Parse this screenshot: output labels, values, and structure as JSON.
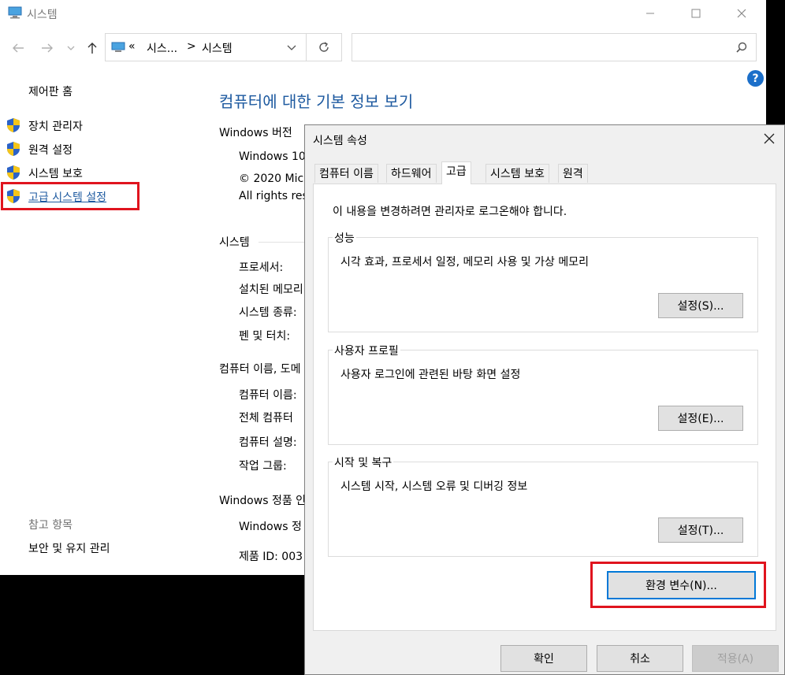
{
  "window": {
    "title": "시스템",
    "address": {
      "prefix": "«",
      "crumb1": "시스...",
      "sep": ">",
      "crumb2": "시스템"
    },
    "search_placeholder": "",
    "help": "?"
  },
  "sidebar": {
    "home": "제어판 홈",
    "items": [
      {
        "label": "장치 관리자"
      },
      {
        "label": "원격 설정"
      },
      {
        "label": "시스템 보호"
      },
      {
        "label": "고급 시스템 설정"
      }
    ],
    "see_also_heading": "참고 항목",
    "see_also": [
      {
        "label": "보안 및 유지 관리"
      }
    ]
  },
  "main": {
    "title": "컴퓨터에 대한 기본 정보 보기",
    "windows_edition": {
      "heading": "Windows 버전",
      "line1": "Windows 10",
      "line2": "© 2020 Mic",
      "line3": "All rights res"
    },
    "system": {
      "heading": "시스템",
      "rows": [
        "프로세서:",
        "설치된 메모리",
        "시스템 종류:",
        "펜 및 터치:"
      ]
    },
    "computer_name": {
      "heading": "컴퓨터 이름, 도메",
      "rows": [
        "컴퓨터 이름:",
        "전체 컴퓨터",
        "컴퓨터 설명:",
        "작업 그룹:"
      ]
    },
    "activation": {
      "heading": "Windows 정품 인",
      "line1": "Windows 정",
      "line2": "제품 ID: 003"
    }
  },
  "dialog": {
    "title": "시스템 속성",
    "tabs": [
      "컴퓨터 이름",
      "하드웨어",
      "고급",
      "시스템 보호",
      "원격"
    ],
    "active_tab": "고급",
    "admin_note": "이 내용을 변경하려면 관리자로 로그온해야 합니다.",
    "groups": [
      {
        "label": "성능",
        "desc": "시각 효과, 프로세서 일정, 메모리 사용 및 가상 메모리",
        "button": "설정(S)..."
      },
      {
        "label": "사용자 프로필",
        "desc": "사용자 로그인에 관련된 바탕 화면 설정",
        "button": "설정(E)..."
      },
      {
        "label": "시작 및 복구",
        "desc": "시스템 시작, 시스템 오류 및 디버깅 정보",
        "button": "설정(T)..."
      }
    ],
    "env_button": "환경 변수(N)...",
    "ok": "확인",
    "cancel": "취소",
    "apply": "적용(A)"
  },
  "colors": {
    "link": "#1e5aa0",
    "highlight": "#e0141e",
    "accent": "#0078d7"
  }
}
